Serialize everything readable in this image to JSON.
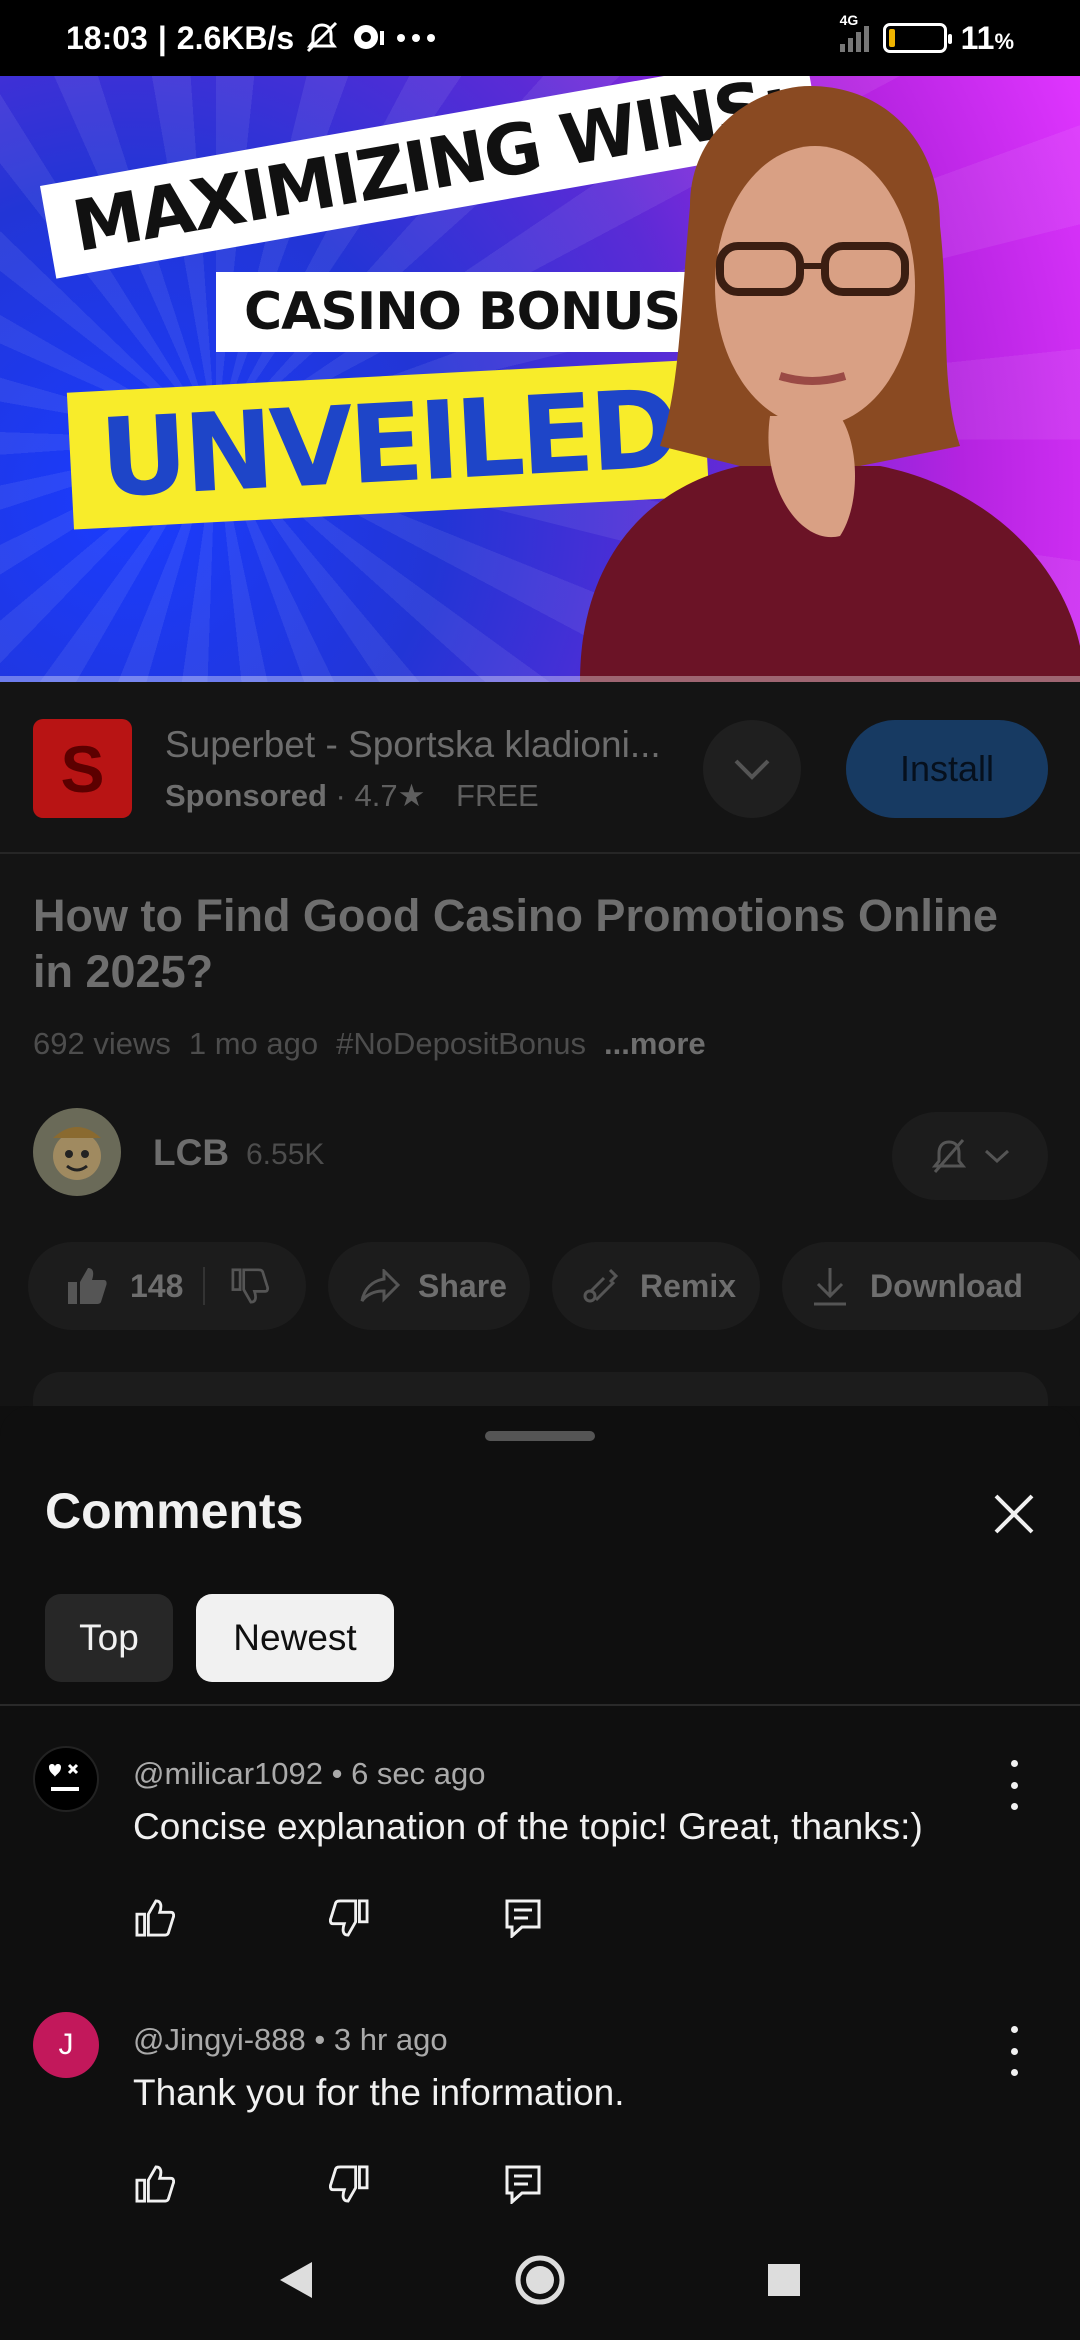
{
  "status_bar": {
    "time": "18:03",
    "speed": "2.6KB/s",
    "network": "4G",
    "battery": "11",
    "battery_unit": "%",
    "battery_level": 0.11,
    "icons": [
      "mute-icon",
      "chat-bubble-icon",
      "more-dots-icon",
      "signal-icon",
      "battery-icon"
    ]
  },
  "video": {
    "thumbnail_line1": "MAXIMIZING WINS:",
    "thumbnail_line2": "CASINO BONUSES",
    "thumbnail_line3": "UNVEILED"
  },
  "ad": {
    "logo_letter": "S",
    "title": "Superbet - Sportska kladioni...",
    "sponsored": "Sponsored",
    "dot": "·",
    "rating": "4.7",
    "price": "FREE",
    "install_label": "Install"
  },
  "video_info": {
    "title": "How to Find Good Casino Promotions Online in 2025?",
    "views": "692 views",
    "age": "1 mo ago",
    "hashtag": "#NoDepositBonus",
    "more": "...more"
  },
  "channel": {
    "name": "LCB",
    "subscribers": "6.55K"
  },
  "actions": {
    "likes": "148",
    "share": "Share",
    "remix": "Remix",
    "download": "Download"
  },
  "comments_sheet": {
    "title": "Comments",
    "tabs": [
      {
        "label": "Top",
        "selected": false
      },
      {
        "label": "Newest",
        "selected": true
      }
    ],
    "comments": [
      {
        "author": "@milicar1092",
        "time": "6 sec ago",
        "text": "Concise explanation of the topic! Great, thanks:)",
        "avatar_color": "#000000"
      },
      {
        "author": "@Jingyi-888",
        "time": "3 hr ago",
        "text": "Thank you for the information.",
        "avatar_letter": "J",
        "avatar_color": "#c2185b"
      }
    ]
  },
  "colors": {
    "background": "#0f0f0f",
    "install_button": "#173a62",
    "ad_logo": "#b81414"
  }
}
